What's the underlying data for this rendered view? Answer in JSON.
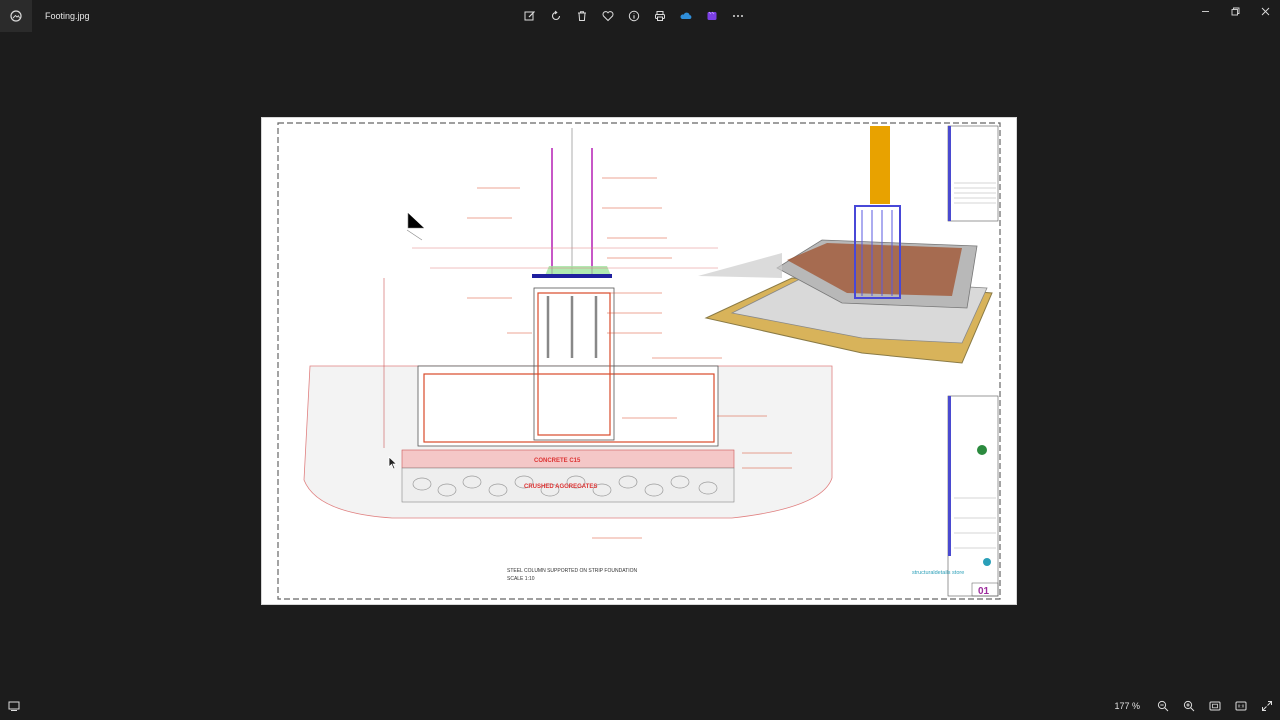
{
  "window": {
    "title": "Footing.jpg",
    "app_icon": "photos-app-icon",
    "controls": [
      "minimize-icon",
      "restore-icon",
      "close-icon"
    ]
  },
  "toolbar": {
    "buttons": [
      {
        "name": "edit-image",
        "icon": "edit-icon"
      },
      {
        "name": "rotate",
        "icon": "rotate-icon"
      },
      {
        "name": "delete",
        "icon": "trash-icon"
      },
      {
        "name": "favorite",
        "icon": "heart-icon"
      },
      {
        "name": "file-info",
        "icon": "info-icon"
      },
      {
        "name": "print",
        "icon": "print-icon"
      },
      {
        "name": "onedrive",
        "icon": "cloud-icon"
      },
      {
        "name": "clipchamp",
        "icon": "clipchamp-icon"
      },
      {
        "name": "more",
        "icon": "more-icon"
      }
    ]
  },
  "image": {
    "description_labels": {
      "caption_line1": "STEEL COLUMN SUPPORTED ON STRIP FOUNDATION",
      "caption_line2": "SCALE 1:10",
      "band_concrete": "CONCRETE C15",
      "band_aggregates": "CRUSHED AGGREGATES",
      "brand": "structuraldetails store",
      "sheet_number": "01"
    },
    "colors": {
      "accent_blue": "#2a9fb8",
      "red_lines": "#d33333",
      "purple": "#9c2b9c",
      "column_orange": "#e8a200"
    }
  },
  "statusbar": {
    "zoom_text": "177 %",
    "buttons": [
      "zoom-out-icon",
      "zoom-in-icon",
      "fit-to-window-icon",
      "actual-size-icon",
      "fullscreen-icon"
    ]
  }
}
